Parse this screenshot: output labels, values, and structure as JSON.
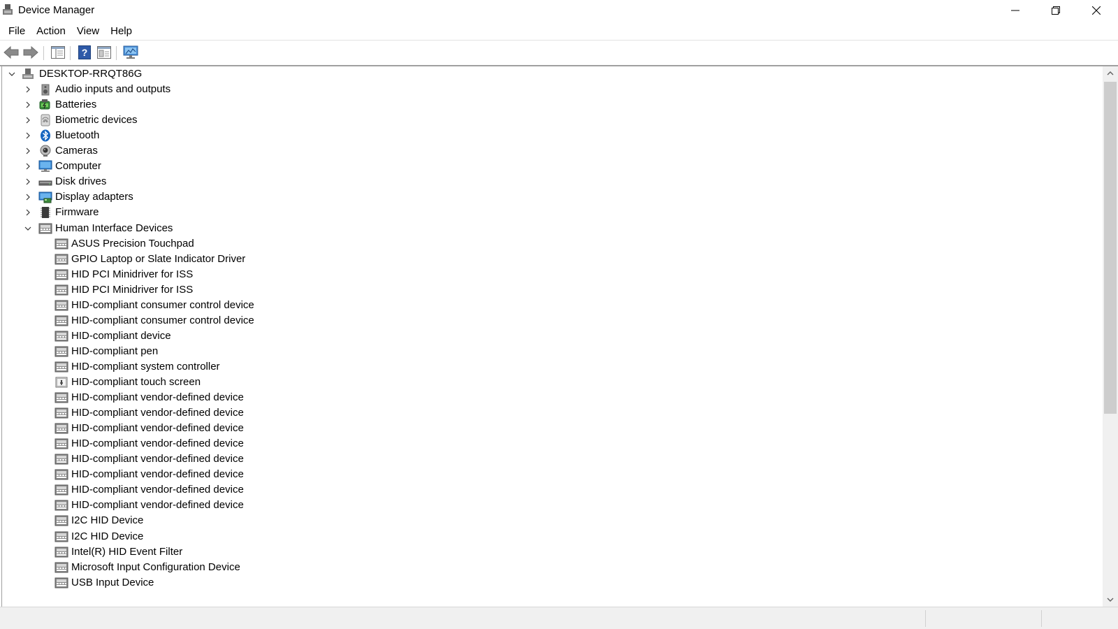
{
  "window": {
    "title": "Device Manager",
    "icon": "device-manager-icon"
  },
  "menu": {
    "items": [
      "File",
      "Action",
      "View",
      "Help"
    ]
  },
  "toolbar": {
    "buttons": [
      "back-arrow-icon",
      "forward-arrow-icon",
      "show-hide-console-tree-icon",
      "help-icon",
      "properties-icon",
      "scan-hardware-icon"
    ]
  },
  "tree": {
    "root": {
      "label": "DESKTOP-RRQT86G",
      "expanded": true
    },
    "categories": [
      {
        "label": "Audio inputs and outputs",
        "icon": "speaker-icon",
        "expanded": false
      },
      {
        "label": "Batteries",
        "icon": "battery-icon",
        "expanded": false
      },
      {
        "label": "Biometric devices",
        "icon": "fingerprint-icon",
        "expanded": false
      },
      {
        "label": "Bluetooth",
        "icon": "bluetooth-icon",
        "expanded": false
      },
      {
        "label": "Cameras",
        "icon": "camera-icon",
        "expanded": false
      },
      {
        "label": "Computer",
        "icon": "monitor-icon",
        "expanded": false
      },
      {
        "label": "Disk drives",
        "icon": "disk-drive-icon",
        "expanded": false
      },
      {
        "label": "Display adapters",
        "icon": "display-adapter-icon",
        "expanded": false
      },
      {
        "label": "Firmware",
        "icon": "firmware-chip-icon",
        "expanded": false
      },
      {
        "label": "Human Interface Devices",
        "icon": "hid-icon",
        "expanded": true
      }
    ],
    "hid_children": [
      {
        "label": "ASUS Precision Touchpad",
        "icon": "hid-icon"
      },
      {
        "label": "GPIO Laptop or Slate Indicator Driver",
        "icon": "hid-icon"
      },
      {
        "label": "HID PCI Minidriver for ISS",
        "icon": "hid-icon"
      },
      {
        "label": "HID PCI Minidriver for ISS",
        "icon": "hid-icon"
      },
      {
        "label": "HID-compliant consumer control device",
        "icon": "hid-icon"
      },
      {
        "label": "HID-compliant consumer control device",
        "icon": "hid-icon"
      },
      {
        "label": "HID-compliant device",
        "icon": "hid-icon"
      },
      {
        "label": "HID-compliant pen",
        "icon": "hid-icon"
      },
      {
        "label": "HID-compliant system controller",
        "icon": "hid-icon"
      },
      {
        "label": "HID-compliant touch screen",
        "icon": "touch-screen-icon"
      },
      {
        "label": "HID-compliant vendor-defined device",
        "icon": "hid-icon"
      },
      {
        "label": "HID-compliant vendor-defined device",
        "icon": "hid-icon"
      },
      {
        "label": "HID-compliant vendor-defined device",
        "icon": "hid-icon"
      },
      {
        "label": "HID-compliant vendor-defined device",
        "icon": "hid-icon"
      },
      {
        "label": "HID-compliant vendor-defined device",
        "icon": "hid-icon"
      },
      {
        "label": "HID-compliant vendor-defined device",
        "icon": "hid-icon"
      },
      {
        "label": "HID-compliant vendor-defined device",
        "icon": "hid-icon"
      },
      {
        "label": "HID-compliant vendor-defined device",
        "icon": "hid-icon"
      },
      {
        "label": "I2C HID Device",
        "icon": "hid-icon"
      },
      {
        "label": "I2C HID Device",
        "icon": "hid-icon"
      },
      {
        "label": "Intel(R) HID Event Filter",
        "icon": "hid-icon"
      },
      {
        "label": "Microsoft Input Configuration Device",
        "icon": "hid-icon"
      },
      {
        "label": "USB Input Device",
        "icon": "hid-icon"
      }
    ]
  }
}
